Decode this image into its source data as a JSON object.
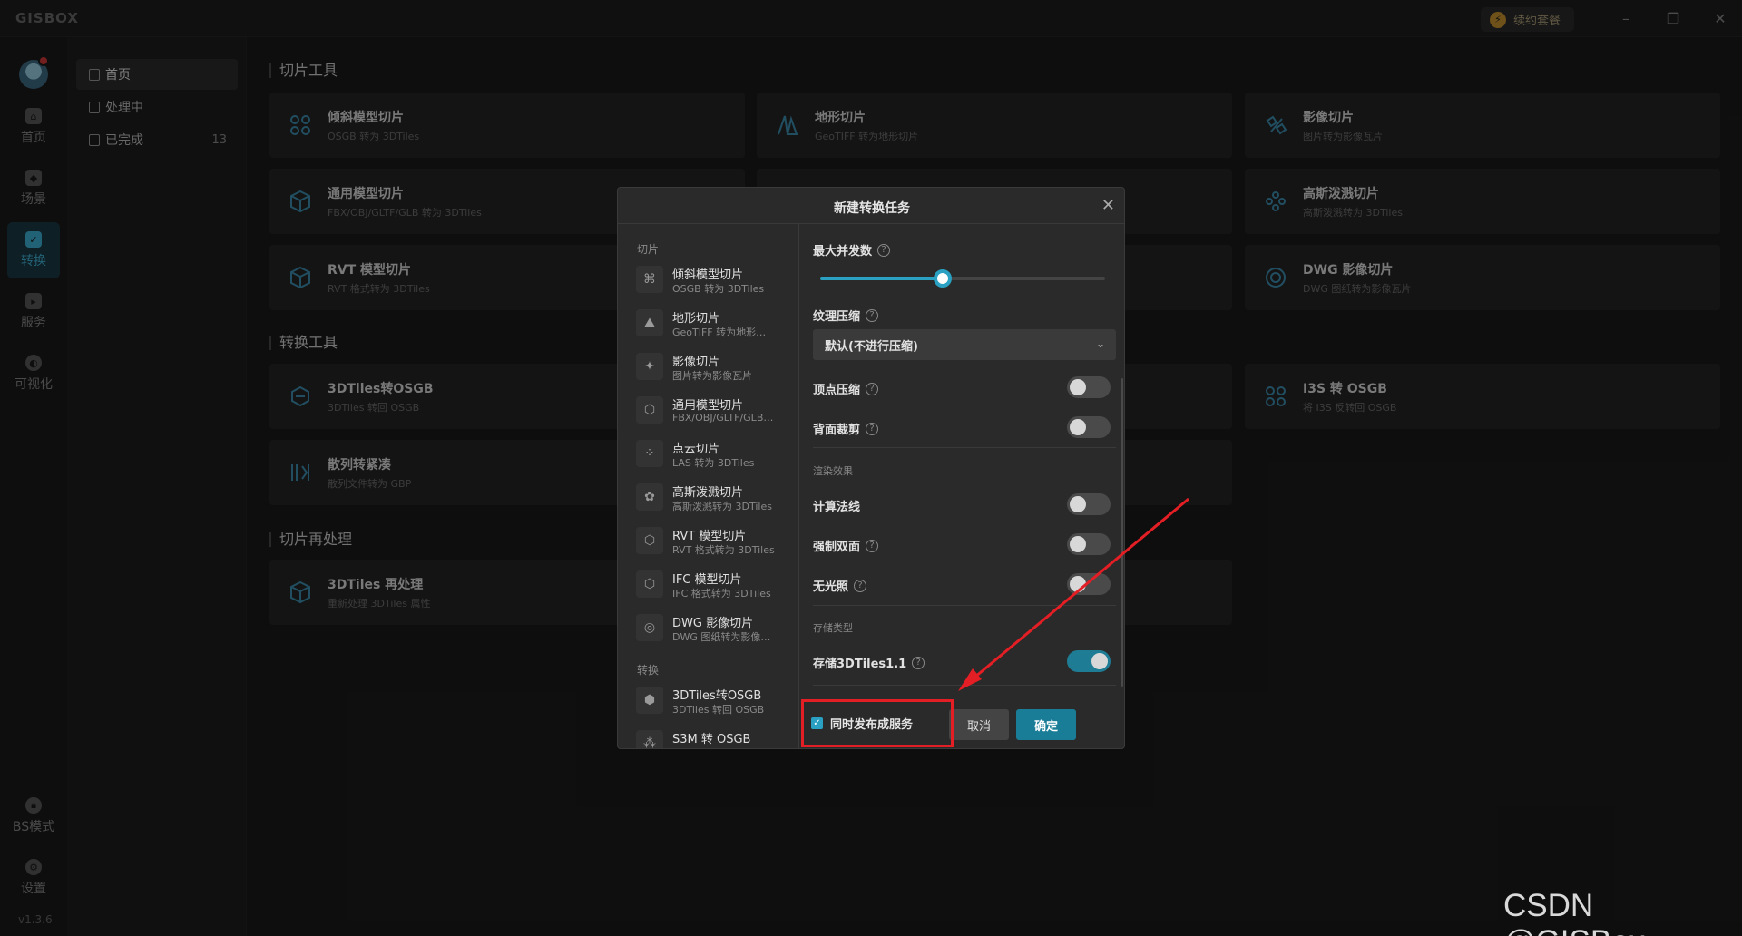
{
  "app": {
    "logo": "GISBOX",
    "renew_label": "续约套餐",
    "version": "v1.3.6"
  },
  "rail": {
    "items": [
      {
        "label": "首页"
      },
      {
        "label": "场景"
      },
      {
        "label": "转换"
      },
      {
        "label": "服务"
      },
      {
        "label": "可视化"
      },
      {
        "label": "BS模式"
      },
      {
        "label": "设置"
      }
    ]
  },
  "subnav": {
    "items": [
      {
        "label": "首页"
      },
      {
        "label": "处理中"
      },
      {
        "label": "已完成",
        "count": "13"
      }
    ]
  },
  "main": {
    "sections": [
      {
        "title": "切片工具"
      },
      {
        "title": "转换工具"
      },
      {
        "title": "切片再处理"
      }
    ],
    "cards": [
      {
        "title": "倾斜模型切片",
        "sub": "OSGB 转为 3DTiles"
      },
      {
        "title": "地形切片",
        "sub": "GeoTIFF 转为地形切片"
      },
      {
        "title": "影像切片",
        "sub": "图片转为影像瓦片"
      },
      {
        "title": "通用模型切片",
        "sub": "FBX/OBJ/GLTF/GLB 转为 3DTiles"
      },
      {
        "title": "高斯泼溅切片",
        "sub": "高斯泼溅转为 3DTiles"
      },
      {
        "title": "RVT 模型切片",
        "sub": "RVT 格式转为 3DTiles"
      },
      {
        "title": "DWG 影像切片",
        "sub": "DWG 图纸转为影像瓦片"
      },
      {
        "title": "3DTiles转OSGB",
        "sub": "3DTiles 转回 OSGB"
      },
      {
        "title": "I3S 转 OSGB",
        "sub": "将 I3S 反转回 OSGB"
      },
      {
        "title": "散列转紧凑",
        "sub": "散列文件转为 GBP"
      },
      {
        "title": "3DTiles 再处理",
        "sub": "重新处理 3DTiles 属性"
      }
    ]
  },
  "dialog": {
    "title": "新建转换任务",
    "left_groups": [
      "切片",
      "转换"
    ],
    "left_items": [
      {
        "title": "倾斜模型切片",
        "sub": "OSGB 转为 3DTiles"
      },
      {
        "title": "地形切片",
        "sub": "GeoTIFF 转为地形…"
      },
      {
        "title": "影像切片",
        "sub": "图片转为影像瓦片"
      },
      {
        "title": "通用模型切片",
        "sub": "FBX/OBJ/GLTF/GLB…"
      },
      {
        "title": "点云切片",
        "sub": "LAS 转为 3DTiles"
      },
      {
        "title": "高斯泼溅切片",
        "sub": "高斯泼溅转为 3DTiles"
      },
      {
        "title": "RVT 模型切片",
        "sub": "RVT 格式转为 3DTiles"
      },
      {
        "title": "IFC 模型切片",
        "sub": "IFC 格式转为 3DTiles"
      },
      {
        "title": "DWG 影像切片",
        "sub": "DWG 图纸转为影像…"
      },
      {
        "title": "3DTiles转OSGB",
        "sub": "3DTiles 转回 OSGB"
      },
      {
        "title": "S3M 转 OSGB",
        "sub": ""
      }
    ],
    "options": {
      "max_concurrency_label": "最大并发数",
      "max_concurrency_level": 0.43,
      "texture_label": "纹理压缩",
      "texture_value": "默认(不进行压缩)",
      "vertex_label": "顶点压缩",
      "vertex_on": false,
      "backface_label": "背面裁剪",
      "backface_on": false,
      "render_group": "渲染效果",
      "normals_label": "计算法线",
      "normals_on": false,
      "double_side_label": "强制双面",
      "double_side_on": false,
      "unlit_label": "无光照",
      "unlit_on": false,
      "storage_group": "存储类型",
      "tiles11_label": "存储3DTiles1.1",
      "tiles11_on": true
    },
    "footer": {
      "publish_label": "同时发布成服务",
      "publish_checked": true,
      "cancel_label": "取消",
      "ok_label": "确定"
    }
  },
  "watermark": "CSDN @GISBox",
  "colors": {
    "accent": "#2aa0c2",
    "annotation": "#e31e24"
  }
}
